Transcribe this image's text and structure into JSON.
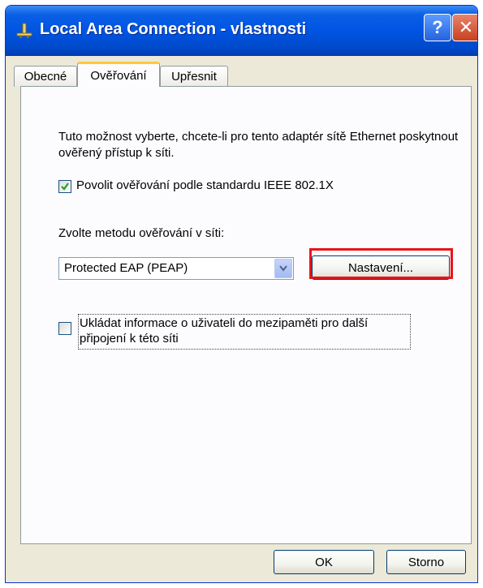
{
  "window": {
    "title": "Local Area Connection - vlastnosti",
    "help_label": "?",
    "close_label": "✕"
  },
  "tabs": [
    {
      "label": "Obecné",
      "active": false
    },
    {
      "label": "Ověřování",
      "active": true
    },
    {
      "label": "Upřesnit",
      "active": false
    }
  ],
  "panel": {
    "description": "Tuto možnost vyberte, chcete-li pro tento adaptér sítě Ethernet poskytnout ověřený přístup k síti.",
    "enable_8021x": {
      "label": "Povolit ověřování podle standardu IEEE 802.1X",
      "checked": true
    },
    "method_label": "Zvolte metodu ověřování v síti:",
    "method_select": {
      "value": "Protected EAP (PEAP)"
    },
    "settings_button": "Nastavení...",
    "cache_user_info": {
      "label": "Ukládat informace o uživateli do mezipaměti pro další připojení k této síti",
      "checked": false
    }
  },
  "footer": {
    "ok_label": "OK",
    "cancel_label": "Storno"
  },
  "colors": {
    "titlebar": "#0054e3",
    "highlight": "#e8141a",
    "active_tab_accent": "#ffc83c"
  }
}
